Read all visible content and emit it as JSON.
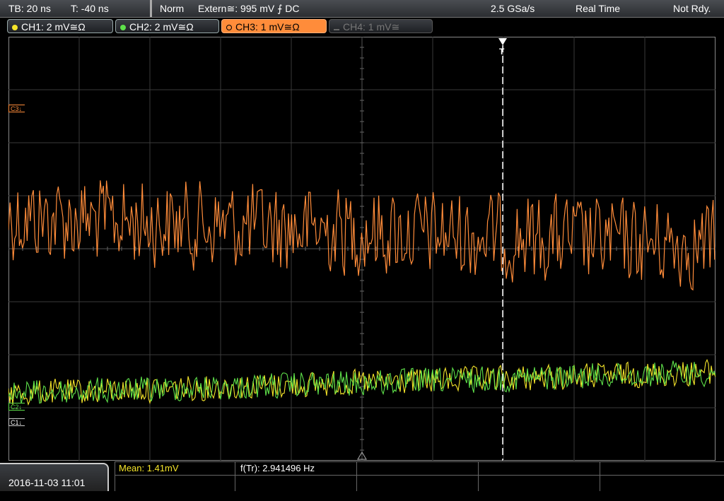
{
  "status_bar": {
    "timebase": "TB: 20 ns",
    "trigger_time": "T: -40 ns",
    "mode": "Norm",
    "trigger": "Extern≅: 995 mV ⨍ DC",
    "sample_rate": "2.5 GSa/s",
    "acquisition": "Real Time",
    "state": "Not Rdy."
  },
  "channels": [
    {
      "label": "CH1: 2 mV≅Ω",
      "color": "#f5e52a",
      "state": "on"
    },
    {
      "label": "CH2: 2 mV≅Ω",
      "color": "#5ee04a",
      "state": "on"
    },
    {
      "label": "CH3: 1 mV≅Ω",
      "color": "#ff8c3a",
      "state": "active"
    },
    {
      "label": "CH4: 1 mV≅",
      "color": "#666666",
      "state": "off"
    }
  ],
  "markers": {
    "c3": "C3↓",
    "c2": "C2↓",
    "c1": "C1↓",
    "trigger": "T"
  },
  "measurements": {
    "mean": "Mean: 1.41mV",
    "freq": "f(Tr): 2.941496 Hz"
  },
  "datetime": "2016-11-03 11:01",
  "colors": {
    "ch1": "#f5e52a",
    "ch2": "#5ee04a",
    "ch3": "#ff8c3a",
    "grid": "#3a3a3a"
  }
}
